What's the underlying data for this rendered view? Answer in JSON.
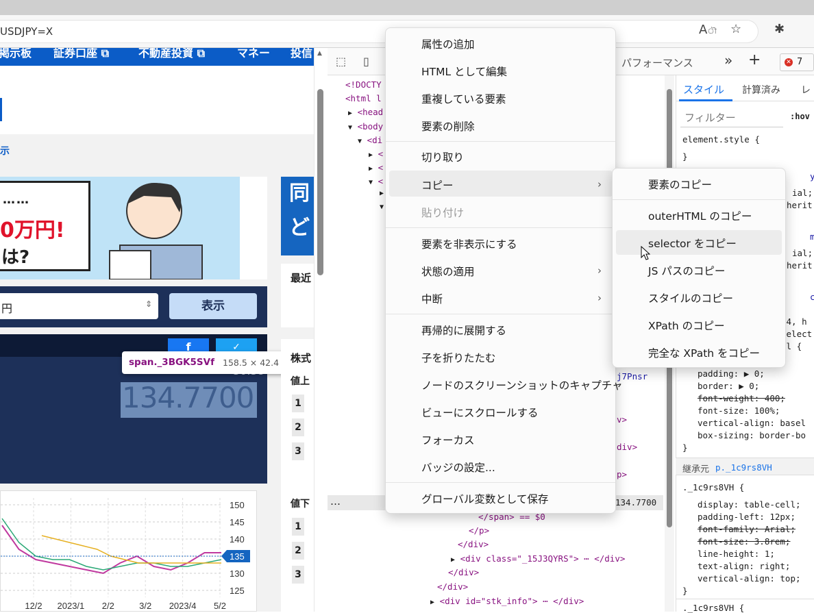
{
  "browser": {
    "url": "USDJPY=X"
  },
  "nav": {
    "items": [
      "掲示板",
      "証券口座 ⧉",
      "不動産投資 ⧉",
      "マネー",
      "投信"
    ]
  },
  "page": {
    "link_text": "示",
    "banner": {
      "line1": "……",
      "line2": "0万円!",
      "line3": "は?"
    },
    "side_banner": "同\nど",
    "select_value": "円",
    "show_button": "表示",
    "share_fb": "f",
    "share_tw": "✓",
    "tooltip": {
      "selector": "span._3BGK5SVf",
      "size": "158.5 × 42.4"
    },
    "price": "134.7700",
    "sub_price": "30.38",
    "recent": "最近",
    "stocks": "株式",
    "up_label": "値上",
    "down_label": "値下",
    "ranks_up": [
      "1",
      "2",
      "3"
    ],
    "ranks_down": [
      "1",
      "2",
      "3"
    ]
  },
  "chart_data": {
    "type": "line",
    "title": "",
    "xlabel": "",
    "ylabel": "",
    "x": [
      "12/2",
      "2023/1",
      "2/2",
      "3/2",
      "2023/4",
      "5/2"
    ],
    "ylim": [
      123,
      152
    ],
    "yticks": [
      "150",
      "145",
      "140",
      "135",
      "130",
      "125"
    ],
    "current": "135",
    "series": [
      {
        "values": [
          144,
          137,
          134,
          133,
          132,
          131,
          130,
          133,
          135,
          132,
          131,
          133,
          136,
          136
        ]
      },
      {
        "values": [
          146,
          139,
          135,
          134,
          134,
          132,
          131,
          132,
          133,
          133,
          132,
          132,
          133,
          134
        ]
      },
      {
        "values": [
          141,
          140,
          139,
          138,
          137,
          135,
          134,
          133,
          133,
          133,
          133,
          133,
          133,
          133
        ]
      }
    ]
  },
  "devtools": {
    "toolbar": {
      "perf_tab": "パフォーマンス",
      "more": "»",
      "add": "+",
      "errors": "7"
    },
    "styles_tabs": [
      "スタイル",
      "計算済み",
      "レ"
    ],
    "filter_placeholder": "フィルター",
    "hov": ":hov",
    "code_lines": [
      "<!DOCTY",
      "<html l",
      "<head",
      "<body",
      "<di",
      "<",
      "<",
      "<",
      "",
      ""
    ],
    "dom_frag": [
      "j7Pnsr",
      "v>",
      "div>",
      "p>"
    ],
    "selected_end": "134.7700",
    "ellipsis": "…",
    "code_bottom": [
      "</span> == $0",
      "</p>",
      "</div>",
      "<div class=\"_15J3QYRS\"> ⋯ </div>",
      "</div>",
      "</div>",
      "<div id=\"stk_info\"> ⋯ </div>"
    ],
    "css_lines": [
      "element.style {",
      "}"
    ],
    "css_frag": [
      "y",
      "ial;",
      "herit;",
      "m",
      "ial;",
      "herit;",
      "c",
      "h4, h",
      "select",
      "ul {"
    ],
    "css_rules": [
      "padding: ▶ 0;",
      "border: ▶ 0;",
      "font-weight: 400;",
      "font-size: 100%;",
      "vertical-align: basel",
      "box-sizing: border-bo",
      "}"
    ],
    "inherit_label": "継承元",
    "inherit_class": "p._1c9rs8VH",
    "rule2_sel": "._1c9rs8VH {",
    "rule2": [
      "display: table-cell;",
      "padding-left: 12px;",
      "font-family: Arial;",
      "font-size: 3.8rem;",
      "line-height: 1;",
      "text-align: right;",
      "vertical-align: top;",
      "}"
    ],
    "rule3_sel": "._1c9rs8VH {"
  },
  "context_menu": {
    "items": [
      "属性の追加",
      "HTML として編集",
      "重複している要素",
      "要素の削除",
      "切り取り",
      "コピー",
      "貼り付け",
      "要素を非表示にする",
      "状態の適用",
      "中断",
      "再帰的に展開する",
      "子を折りたたむ",
      "ノードのスクリーンショットのキャプチャ",
      "ビューにスクロールする",
      "フォーカス",
      "バッジの設定...",
      "グローバル変数として保存"
    ]
  },
  "copy_submenu": {
    "items": [
      "要素のコピー",
      "outerHTML のコピー",
      "selector をコピー",
      "JS パスのコピー",
      "スタイルのコピー",
      "XPath のコピー",
      "完全な XPath をコピー"
    ]
  }
}
